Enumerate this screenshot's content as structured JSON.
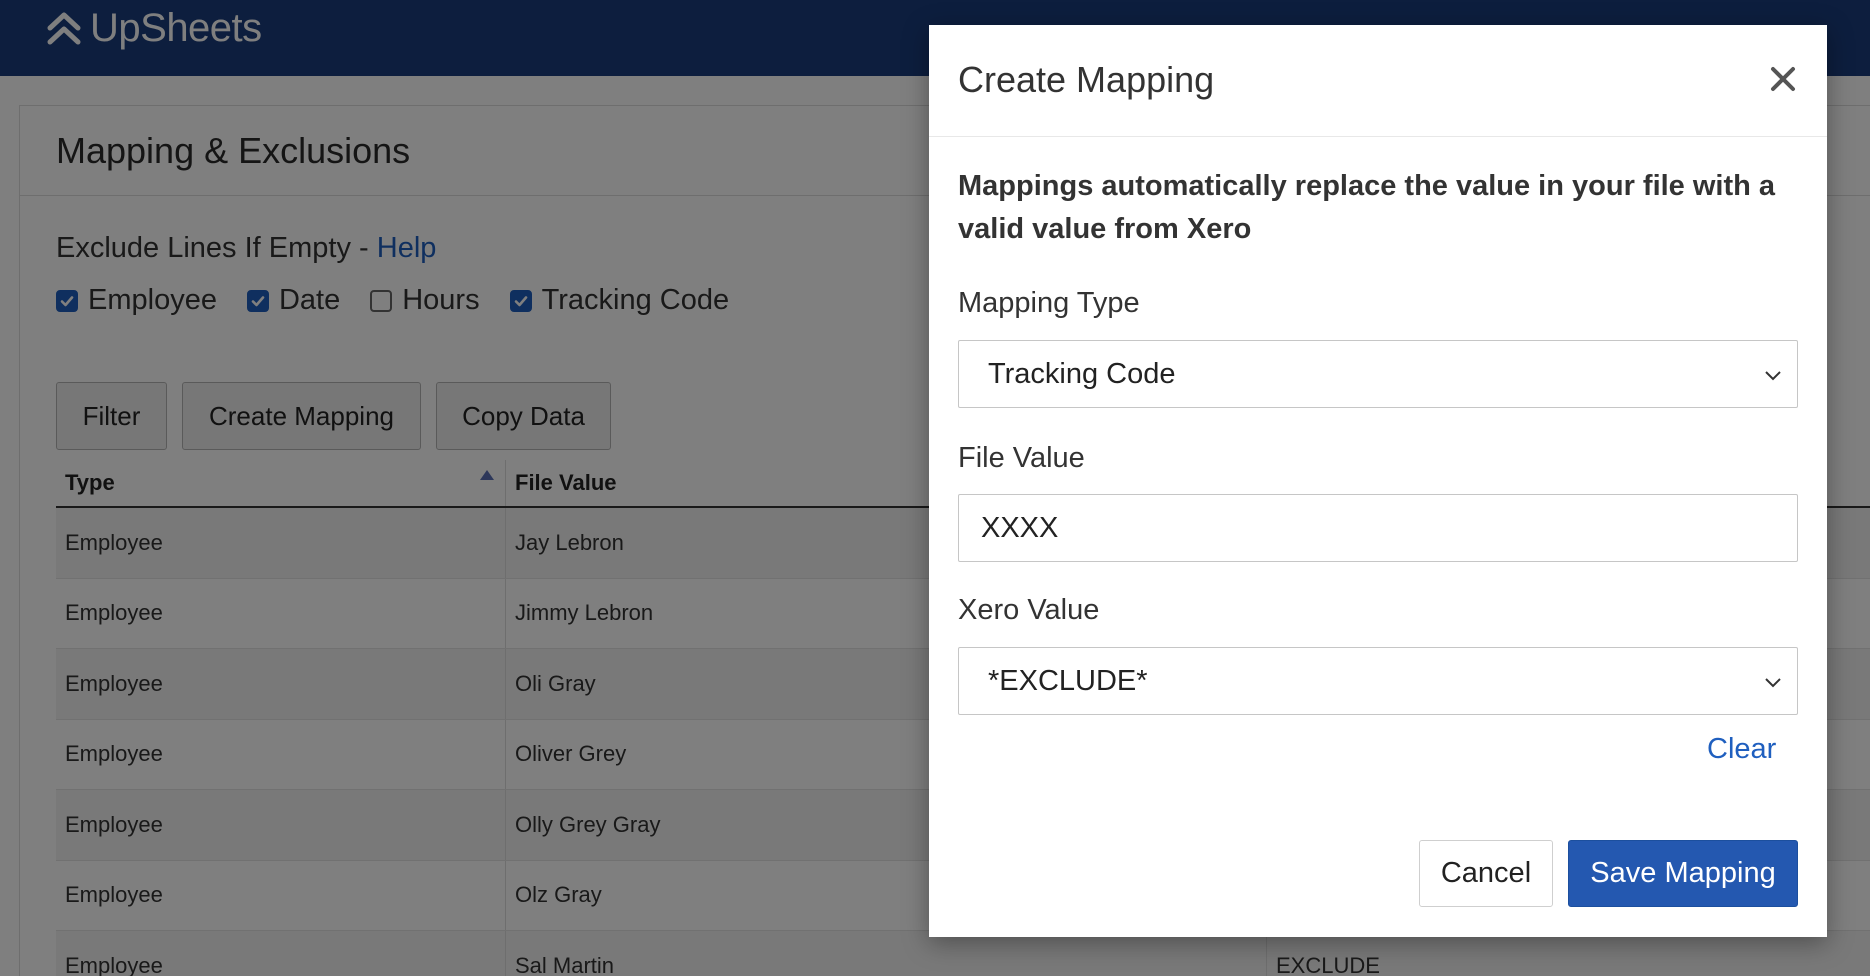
{
  "app": {
    "name": "UpSheets",
    "brand_color": "#1a3d7c",
    "accent_color": "#1f5fbf",
    "logo_icon": "double-chevron-up-icon"
  },
  "page": {
    "title": "Mapping & Exclusions",
    "exclude_label": "Exclude Lines If Empty - ",
    "help_link": "Help",
    "checkboxes": [
      {
        "label": "Employee",
        "checked": true
      },
      {
        "label": "Date",
        "checked": true
      },
      {
        "label": "Hours",
        "checked": false
      },
      {
        "label": "Tracking Code",
        "checked": true
      }
    ],
    "buttons": {
      "filter": "Filter",
      "create_mapping": "Create Mapping",
      "copy_data": "Copy Data"
    },
    "table": {
      "columns": [
        "Type",
        "File Value"
      ],
      "sort_column": "Type",
      "sort_direction": "ascending",
      "rows": [
        {
          "type": "Employee",
          "file_value": "Jay Lebron",
          "xero_value": ""
        },
        {
          "type": "Employee",
          "file_value": "Jimmy Lebron",
          "xero_value": ""
        },
        {
          "type": "Employee",
          "file_value": "Oli Gray",
          "xero_value": ""
        },
        {
          "type": "Employee",
          "file_value": "Oliver Grey",
          "xero_value": ""
        },
        {
          "type": "Employee",
          "file_value": "Olly Grey Gray",
          "xero_value": ""
        },
        {
          "type": "Employee",
          "file_value": "Olz Gray",
          "xero_value": ""
        },
        {
          "type": "Employee",
          "file_value": "Sal Martin",
          "xero_value": "EXCLUDE"
        }
      ]
    }
  },
  "modal": {
    "title": "Create Mapping",
    "close_icon": "close-icon",
    "description": "Mappings automatically replace the value in your file with a valid value from Xero",
    "mapping_type": {
      "label": "Mapping Type",
      "value": "Tracking Code"
    },
    "file_value": {
      "label": "File Value",
      "value": "XXXX"
    },
    "xero_value": {
      "label": "Xero Value",
      "value": "*EXCLUDE*"
    },
    "clear_link": "Clear",
    "cancel_label": "Cancel",
    "save_label": "Save Mapping"
  }
}
